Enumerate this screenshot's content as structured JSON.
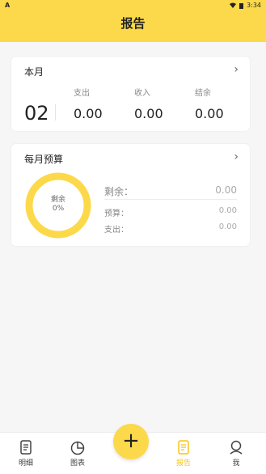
{
  "status": {
    "left": "A",
    "time": "3:34"
  },
  "title": "报告",
  "month_card": {
    "title": "本月",
    "day": "02",
    "columns": [
      {
        "label": "支出",
        "value": "0.00"
      },
      {
        "label": "收入",
        "value": "0.00"
      },
      {
        "label": "结余",
        "value": "0.00"
      }
    ]
  },
  "budget_card": {
    "title": "每月预算",
    "ring_label": "剩余",
    "ring_percent": "0%",
    "remaining_label": "剩余：",
    "remaining_value": "0.00",
    "budget_label": "预算：",
    "budget_value": "0.00",
    "expense_label": "支出：",
    "expense_value": "0.00"
  },
  "tabs": [
    {
      "label": "明细",
      "icon": "detail-icon"
    },
    {
      "label": "图表",
      "icon": "chart-icon"
    },
    {
      "label": "报告",
      "icon": "report-icon",
      "active": true
    },
    {
      "label": "我",
      "icon": "user-icon"
    }
  ],
  "fab_label": "+",
  "colors": {
    "accent": "#fcd94a"
  }
}
